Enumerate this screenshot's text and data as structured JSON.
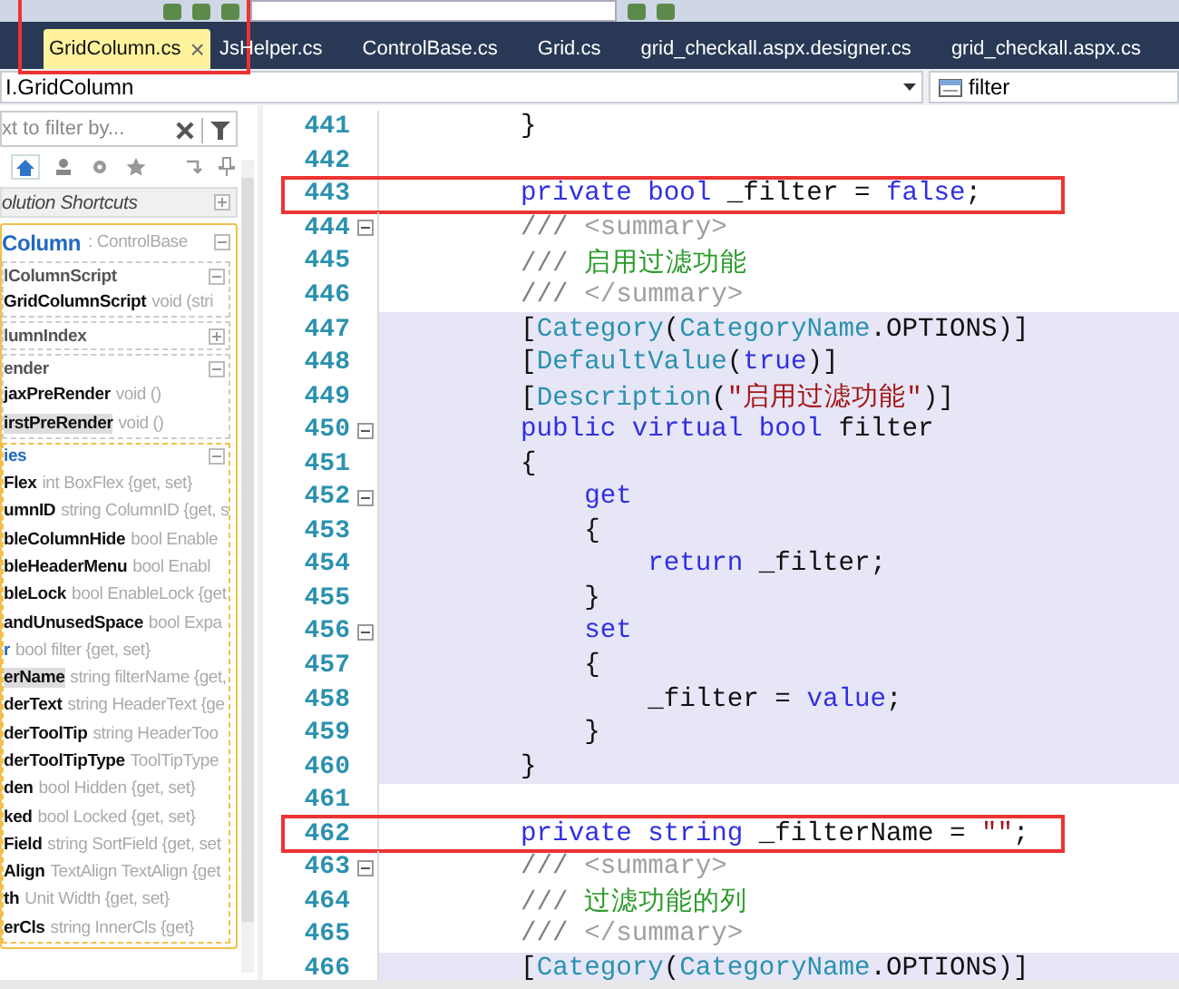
{
  "tabs": [
    {
      "label": "GridColumn.cs",
      "selected": true,
      "annotated": true,
      "close": "×"
    },
    {
      "label": "JsHelper.cs",
      "selected": false,
      "annotated": false
    },
    {
      "label": "ControlBase.cs",
      "selected": false,
      "annotated": false
    },
    {
      "label": "Grid.cs",
      "selected": false,
      "annotated": false
    },
    {
      "label": "grid_checkall.aspx.designer.cs",
      "selected": false,
      "annotated": false
    },
    {
      "label": "grid_checkall.aspx.cs",
      "selected": false,
      "annotated": false
    }
  ],
  "navigation": {
    "type_box": "I.GridColumn",
    "member_box": "filter"
  },
  "class_view": {
    "filter_placeholder": "xt to filter by...",
    "shortcuts": "olution Shortcuts",
    "class_name": "Column",
    "class_base": ": ControlBase",
    "groups": [
      {
        "title": "lColumnScript",
        "expanded": true,
        "kind": "methods",
        "items": [
          {
            "name": "GridColumnScript",
            "signature": "void (stri",
            "selected": false,
            "matched": false
          }
        ]
      },
      {
        "title": "lumnIndex",
        "expanded": false,
        "kind": "methods"
      },
      {
        "title": "ender",
        "expanded": true,
        "kind": "methods",
        "items": [
          {
            "name": "jaxPreRender",
            "signature": "void ()",
            "selected": false,
            "matched": false
          },
          {
            "name": "irstPreRender",
            "signature": "void ()",
            "selected": true,
            "matched": false
          }
        ]
      },
      {
        "title": "ies",
        "expanded": true,
        "kind": "properties",
        "items": [
          {
            "name": "Flex",
            "signature": "int BoxFlex {get, set}",
            "selected": false,
            "matched": false
          },
          {
            "name": "umnID",
            "signature": "string ColumnID {get, s",
            "selected": false,
            "matched": false
          },
          {
            "name": "bleColumnHide",
            "signature": "bool Enable",
            "selected": false,
            "matched": false
          },
          {
            "name": "bleHeaderMenu",
            "signature": "bool Enabl",
            "selected": false,
            "matched": false
          },
          {
            "name": "bleLock",
            "signature": "bool EnableLock {get",
            "selected": false,
            "matched": false
          },
          {
            "name": "andUnusedSpace",
            "signature": "bool Expa",
            "selected": false,
            "matched": false
          },
          {
            "name": "r",
            "signature": "bool filter {get, set}",
            "selected": false,
            "matched": true
          },
          {
            "name": "erName",
            "signature": "string filterName {get,",
            "selected": true,
            "matched": false
          },
          {
            "name": "derText",
            "signature": "string HeaderText {ge",
            "selected": false,
            "matched": false
          },
          {
            "name": "derToolTip",
            "signature": "string HeaderToo",
            "selected": false,
            "matched": false
          },
          {
            "name": "derToolTipType",
            "signature": "ToolTipType",
            "selected": false,
            "matched": false
          },
          {
            "name": "den",
            "signature": "bool Hidden {get, set}",
            "selected": false,
            "matched": false
          },
          {
            "name": "ked",
            "signature": "bool Locked {get, set}",
            "selected": false,
            "matched": false
          },
          {
            "name": "Field",
            "signature": "string SortField {get, set",
            "selected": false,
            "matched": false
          },
          {
            "name": "Align",
            "signature": "TextAlign TextAlign {get",
            "selected": false,
            "matched": false
          },
          {
            "name": "th",
            "signature": "Unit Width {get, set}",
            "selected": false,
            "matched": false
          },
          {
            "name": "erCls",
            "signature": "string InnerCls {get}",
            "selected": false,
            "matched": false
          }
        ]
      }
    ]
  },
  "code_lines": [
    {
      "number": "441",
      "fold": false,
      "shaded": false,
      "boxed": false,
      "tokens": [
        {
          "kind": "plain",
          "text": "        }"
        }
      ]
    },
    {
      "number": "442",
      "fold": false,
      "shaded": false,
      "boxed": false
    },
    {
      "number": "443",
      "fold": false,
      "shaded": false,
      "boxed": true,
      "tokens": [
        {
          "kind": "keyword",
          "text": "        private "
        },
        {
          "kind": "keyword",
          "text": "bool"
        },
        {
          "kind": "plain",
          "text": " _filter = "
        },
        {
          "kind": "keyword",
          "text": "false"
        },
        {
          "kind": "plain",
          "text": ";"
        }
      ]
    },
    {
      "number": "444",
      "fold": true,
      "shaded": false,
      "boxed": false,
      "tokens": [
        {
          "kind": "comment",
          "text": "        /// "
        },
        {
          "kind": "doc_tag",
          "text": "<summary>"
        }
      ]
    },
    {
      "number": "445",
      "fold": false,
      "shaded": false,
      "boxed": false,
      "tokens": [
        {
          "kind": "comment",
          "text": "        /// "
        },
        {
          "kind": "doc_text",
          "text": "启用过滤功能"
        }
      ]
    },
    {
      "number": "446",
      "fold": false,
      "shaded": false,
      "boxed": false,
      "tokens": [
        {
          "kind": "comment",
          "text": "        /// "
        },
        {
          "kind": "doc_tag",
          "text": "</summary>"
        }
      ]
    },
    {
      "number": "447",
      "fold": false,
      "shaded": true,
      "boxed": false,
      "tokens": [
        {
          "kind": "plain",
          "text": "        ["
        },
        {
          "kind": "type",
          "text": "Category"
        },
        {
          "kind": "plain",
          "text": "("
        },
        {
          "kind": "type",
          "text": "CategoryName"
        },
        {
          "kind": "plain",
          "text": ".OPTIONS)]"
        }
      ]
    },
    {
      "number": "448",
      "fold": false,
      "shaded": true,
      "boxed": false,
      "tokens": [
        {
          "kind": "plain",
          "text": "        ["
        },
        {
          "kind": "type",
          "text": "DefaultValue"
        },
        {
          "kind": "plain",
          "text": "("
        },
        {
          "kind": "keyword",
          "text": "true"
        },
        {
          "kind": "plain",
          "text": ")]"
        }
      ]
    },
    {
      "number": "449",
      "fold": false,
      "shaded": true,
      "boxed": false,
      "tokens": [
        {
          "kind": "plain",
          "text": "        ["
        },
        {
          "kind": "type",
          "text": "Description"
        },
        {
          "kind": "plain",
          "text": "("
        },
        {
          "kind": "string",
          "text": "\"启用过滤功能\""
        },
        {
          "kind": "plain",
          "text": ")]"
        }
      ]
    },
    {
      "number": "450",
      "fold": true,
      "shaded": true,
      "boxed": false,
      "tokens": [
        {
          "kind": "keyword",
          "text": "        public virtual bool"
        },
        {
          "kind": "plain",
          "text": " filter"
        }
      ]
    },
    {
      "number": "451",
      "fold": false,
      "shaded": true,
      "boxed": false,
      "tokens": [
        {
          "kind": "plain",
          "text": "        {"
        }
      ]
    },
    {
      "number": "452",
      "fold": true,
      "shaded": true,
      "boxed": false,
      "tokens": [
        {
          "kind": "keyword",
          "text": "            get"
        }
      ]
    },
    {
      "number": "453",
      "fold": false,
      "shaded": true,
      "boxed": false,
      "tokens": [
        {
          "kind": "plain",
          "text": "            {"
        }
      ]
    },
    {
      "number": "454",
      "fold": false,
      "shaded": true,
      "boxed": false,
      "tokens": [
        {
          "kind": "keyword",
          "text": "                return"
        },
        {
          "kind": "plain",
          "text": " _filter;"
        }
      ]
    },
    {
      "number": "455",
      "fold": false,
      "shaded": true,
      "boxed": false,
      "tokens": [
        {
          "kind": "plain",
          "text": "            }"
        }
      ]
    },
    {
      "number": "456",
      "fold": true,
      "shaded": true,
      "boxed": false,
      "tokens": [
        {
          "kind": "keyword",
          "text": "            set"
        }
      ]
    },
    {
      "number": "457",
      "fold": false,
      "shaded": true,
      "boxed": false,
      "tokens": [
        {
          "kind": "plain",
          "text": "            {"
        }
      ]
    },
    {
      "number": "458",
      "fold": false,
      "shaded": true,
      "boxed": false,
      "tokens": [
        {
          "kind": "plain",
          "text": "                _filter = "
        },
        {
          "kind": "keyword",
          "text": "value"
        },
        {
          "kind": "plain",
          "text": ";"
        }
      ]
    },
    {
      "number": "459",
      "fold": false,
      "shaded": true,
      "boxed": false,
      "tokens": [
        {
          "kind": "plain",
          "text": "            }"
        }
      ]
    },
    {
      "number": "460",
      "fold": false,
      "shaded": true,
      "boxed": false,
      "tokens": [
        {
          "kind": "plain",
          "text": "        }"
        }
      ]
    },
    {
      "number": "461",
      "fold": false,
      "shaded": false,
      "boxed": false
    },
    {
      "number": "462",
      "fold": false,
      "shaded": false,
      "boxed": true,
      "tokens": [
        {
          "kind": "keyword",
          "text": "        private string"
        },
        {
          "kind": "plain",
          "text": " _filterName = "
        },
        {
          "kind": "string",
          "text": "\"\""
        },
        {
          "kind": "plain",
          "text": ";"
        }
      ]
    },
    {
      "number": "463",
      "fold": true,
      "shaded": false,
      "boxed": false,
      "tokens": [
        {
          "kind": "comment",
          "text": "        /// "
        },
        {
          "kind": "doc_tag",
          "text": "<summary>"
        }
      ]
    },
    {
      "number": "464",
      "fold": false,
      "shaded": false,
      "boxed": false,
      "tokens": [
        {
          "kind": "comment",
          "text": "        /// "
        },
        {
          "kind": "doc_text",
          "text": "过滤功能的列"
        }
      ]
    },
    {
      "number": "465",
      "fold": false,
      "shaded": false,
      "boxed": false,
      "tokens": [
        {
          "kind": "comment",
          "text": "        /// "
        },
        {
          "kind": "doc_tag",
          "text": "</summary>"
        }
      ]
    },
    {
      "number": "466",
      "fold": false,
      "shaded": true,
      "boxed": false,
      "tokens": [
        {
          "kind": "plain",
          "text": "        ["
        },
        {
          "kind": "type",
          "text": "Category"
        },
        {
          "kind": "plain",
          "text": "("
        },
        {
          "kind": "type",
          "text": "CategoryName"
        },
        {
          "kind": "plain",
          "text": ".OPTIONS)]"
        }
      ]
    }
  ]
}
